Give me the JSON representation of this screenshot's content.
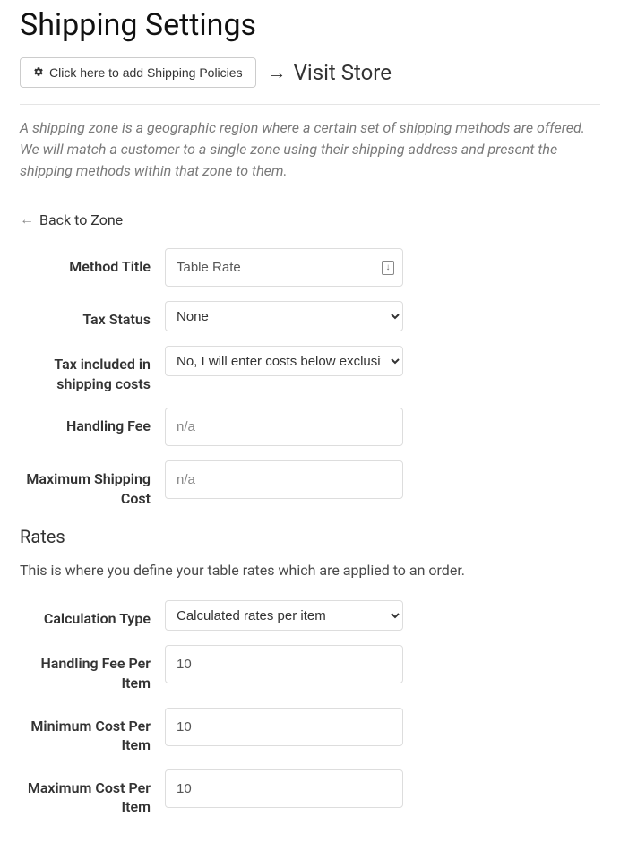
{
  "page_title": "Shipping Settings",
  "add_policies_label": "Click here to add Shipping Policies",
  "visit_store_label": "Visit Store",
  "description": "A shipping zone is a geographic region where a certain set of shipping methods are offered. We will match a customer to a single zone using their shipping address and present the shipping methods within that zone to them.",
  "back_to_zone": "Back to Zone",
  "form": {
    "method_title_label": "Method Title",
    "method_title_value": "Table Rate",
    "tax_status_label": "Tax Status",
    "tax_status_value": "None",
    "tax_included_label": "Tax included in shipping costs",
    "tax_included_value": "No, I will enter costs below exclusive of tax",
    "handling_fee_label": "Handling Fee",
    "handling_fee_placeholder": "n/a",
    "max_shipping_cost_label": "Maximum Shipping Cost",
    "max_shipping_cost_placeholder": "n/a"
  },
  "rates": {
    "title": "Rates",
    "desc": "This is where you define your table rates which are applied to an order.",
    "calc_type_label": "Calculation Type",
    "calc_type_value": "Calculated rates per item",
    "handling_fee_per_item_label": "Handling Fee Per Item",
    "handling_fee_per_item_value": "10",
    "min_cost_per_item_label": "Minimum Cost Per Item",
    "min_cost_per_item_value": "10",
    "max_cost_per_item_label": "Maximum Cost Per Item",
    "max_cost_per_item_value": "10"
  }
}
